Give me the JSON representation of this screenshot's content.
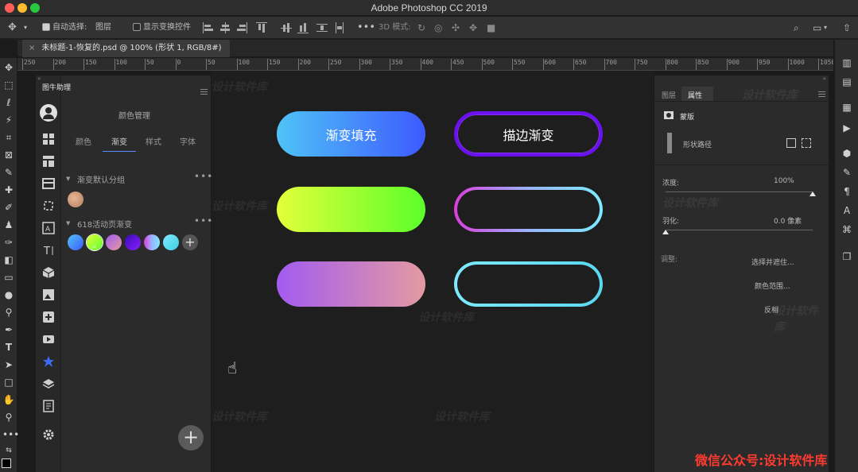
{
  "app": {
    "title": "Adobe Photoshop CC 2019"
  },
  "options_bar": {
    "auto_select_label": "自动选择:",
    "auto_select_value": "图层",
    "show_transform_label": "显示变换控件",
    "mode_3d_label": "3D 模式:"
  },
  "document": {
    "tab_label": "未标题-1-恢复的.psd @ 100% (形状 1, RGB/8#)"
  },
  "ruler": {
    "ticks": [
      "250",
      "200",
      "150",
      "100",
      "50",
      "0",
      "50",
      "100",
      "150",
      "200",
      "250",
      "300",
      "350",
      "400",
      "450",
      "500",
      "550",
      "600",
      "650",
      "700",
      "750",
      "800",
      "850",
      "900",
      "950",
      "1000",
      "1050"
    ]
  },
  "plugin": {
    "tab": "图牛助理",
    "header": "颜色管理",
    "subtabs": [
      "颜色",
      "渐变",
      "样式",
      "字体"
    ],
    "active_subtab": "渐变",
    "group1": "渐变默认分组",
    "group2": "618活动页渐变"
  },
  "canvas": {
    "buttons": [
      {
        "label": "渐变填充",
        "style": "gradient-fill"
      },
      {
        "label": "描边渐变",
        "style": "gradient-stroke"
      }
    ],
    "colors": {
      "blue_start": "#4fc3f7",
      "blue_end": "#3d5afe",
      "purple_stroke": "#6a11f0",
      "lime_start": "#e3ff3a",
      "lime_end": "#5cff2a",
      "violet_start": "#a35bf0",
      "violet_end": "#e39aa2",
      "magenta_stroke": "#d93fd9",
      "cyan_stroke": "#7ee9ff"
    }
  },
  "properties": {
    "tabs": [
      "图层",
      "属性"
    ],
    "active_tab": "属性",
    "mask_label": "蒙版",
    "shape_path_label": "形状路径",
    "density_label": "浓度:",
    "density_value": "100%",
    "density_level": 1.0,
    "feather_label": "羽化:",
    "feather_value": "0.0 像素",
    "feather_level": 0.0,
    "adjust_label": "调整:",
    "select_subject": "选择并遮住...",
    "color_range": "颜色范围...",
    "invert": "反相"
  },
  "watermark_text": "设计软件库",
  "wechat_banner": "微信公众号:设计软件库"
}
